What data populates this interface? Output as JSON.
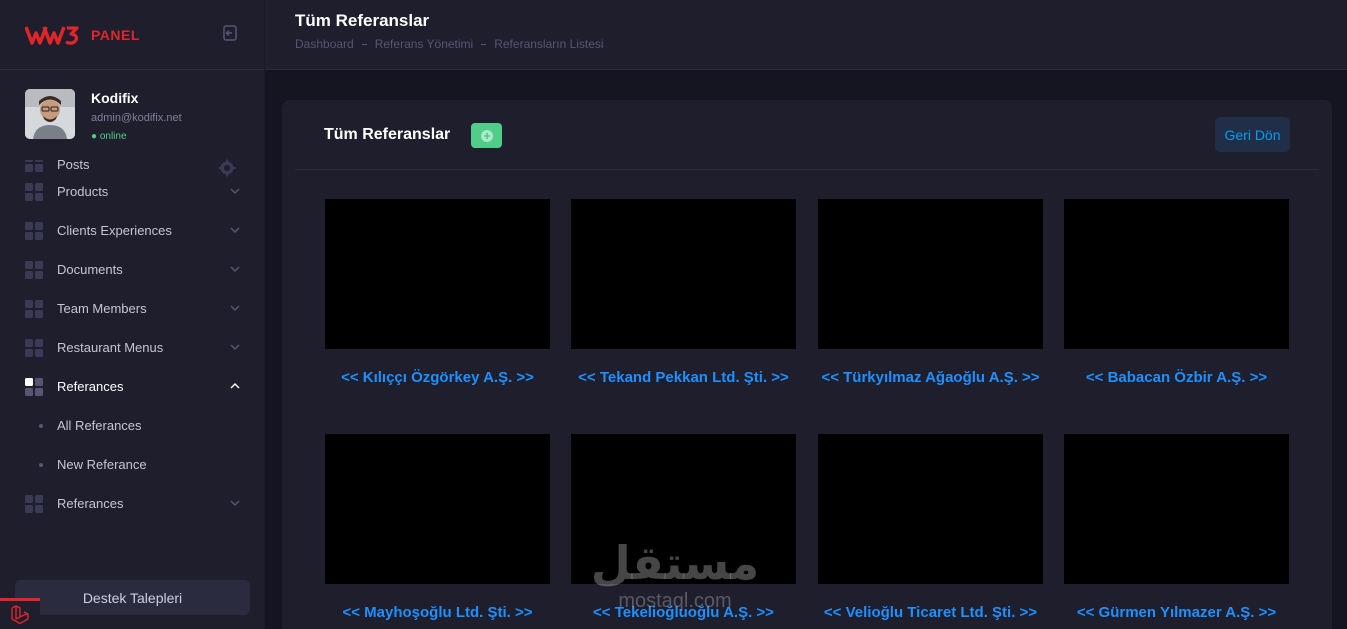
{
  "brand": {
    "text": "PANEL"
  },
  "user": {
    "name": "Kodifix",
    "email": "admin@kodifix.net",
    "status": "online"
  },
  "menu": {
    "partial_item": "Posts",
    "items": [
      {
        "label": "Products"
      },
      {
        "label": "Clients Experiences"
      },
      {
        "label": "Documents"
      },
      {
        "label": "Team Members"
      },
      {
        "label": "Restaurant Menus"
      }
    ],
    "active": {
      "label": "Referances"
    },
    "subitems": [
      {
        "label": "All Referances"
      },
      {
        "label": "New Referance"
      }
    ],
    "last": {
      "label": "Referances"
    }
  },
  "support": {
    "label": "Destek Talepleri"
  },
  "header": {
    "title": "Tüm Referanslar",
    "breadcrumb": [
      "Dashboard",
      "Referans Yönetimi",
      "Referansların Listesi"
    ]
  },
  "card": {
    "title": "Tüm Referanslar",
    "back_label": "Geri Dön"
  },
  "references": [
    {
      "caption": "<< Kılıççı Özgörkey A.Ş. >>"
    },
    {
      "caption": "<< Tekand Pekkan Ltd. Şti. >>"
    },
    {
      "caption": "<< Türkyılmaz Ağaoğlu A.Ş. >>"
    },
    {
      "caption": "<< Babacan Özbir A.Ş. >>"
    },
    {
      "caption": "<< Mayhoşoğlu Ltd. Şti. >>"
    },
    {
      "caption": "<< Tekelioğluoğlu A.Ş. >>"
    },
    {
      "caption": "<< Velioğlu Ticaret Ltd. Şti. >>"
    },
    {
      "caption": "<< Gürmen Yılmazer A.Ş. >>"
    }
  ],
  "watermark": {
    "arabic": "مستقل",
    "url": "mostaql.com"
  },
  "colors": {
    "background": "#151521",
    "panel": "#1e1e2d",
    "accent_blue": "#1e90ff",
    "brand_red": "#e1252a",
    "success_green": "#50cd89"
  }
}
